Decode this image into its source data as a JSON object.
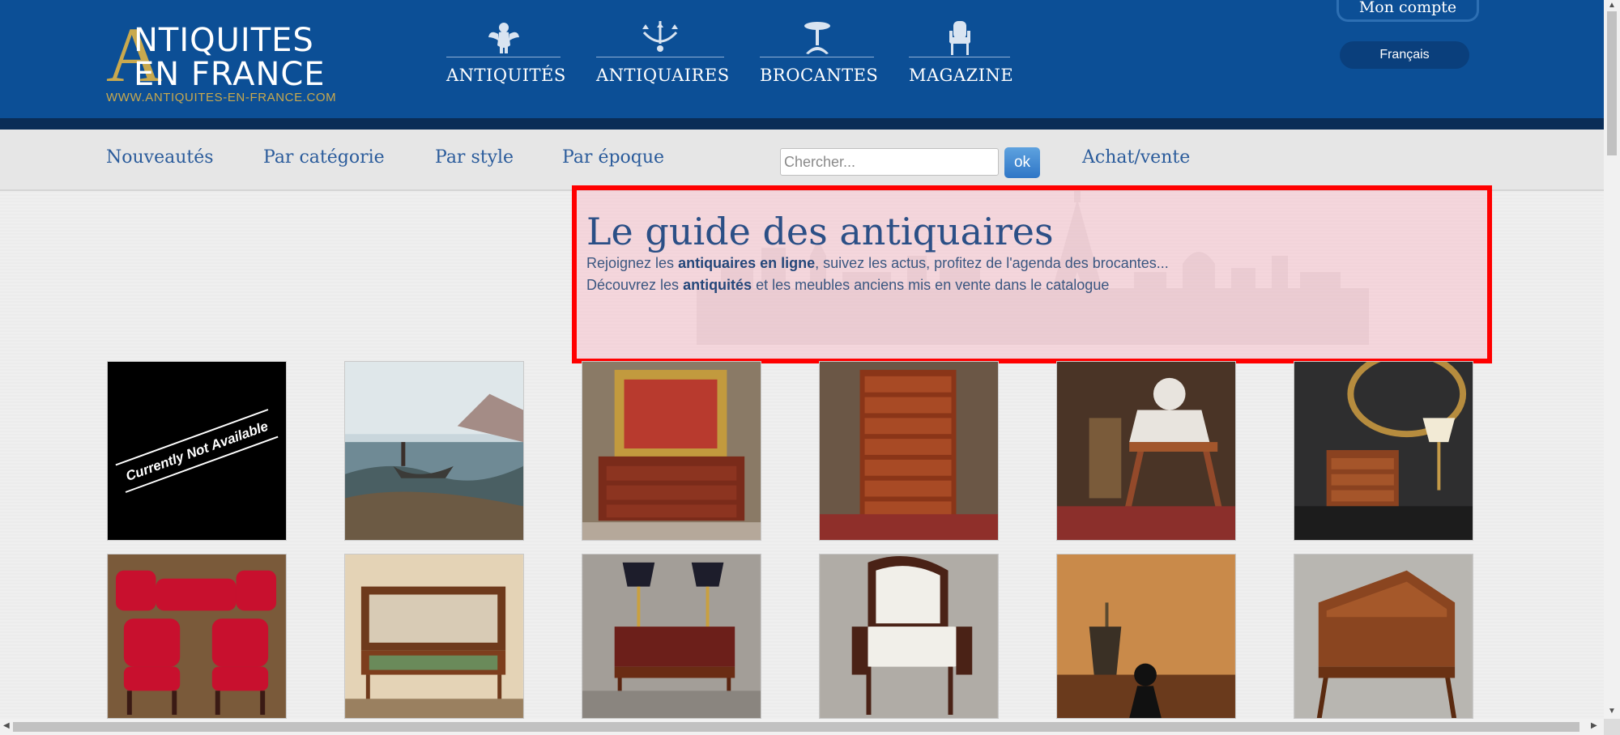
{
  "logo": {
    "big_letter": "A",
    "line1": "NTIQUITES",
    "line2": "EN FRANCE",
    "url": "WWW.ANTIQUITES-EN-FRANCE.COM"
  },
  "main_nav": [
    {
      "label": "ANTIQUITÉS",
      "icon": "cherub-icon"
    },
    {
      "label": "ANTIQUAIRES",
      "icon": "chandelier-icon"
    },
    {
      "label": "BROCANTES",
      "icon": "gueridon-table-icon"
    },
    {
      "label": "MAGAZINE",
      "icon": "armchair-icon"
    }
  ],
  "account": {
    "label": "Mon compte"
  },
  "language": {
    "label": "Français"
  },
  "sub_nav": {
    "links": [
      "Nouveautés",
      "Par catégorie",
      "Par style",
      "Par époque"
    ],
    "search_placeholder": "Chercher...",
    "search_button": "ok",
    "achat_vente": "Achat/vente"
  },
  "hero": {
    "title": "Le guide des antiquaires",
    "line1_prefix": "Rejoignez les ",
    "line1_bold": "antiquaires en ligne",
    "line1_suffix": ", suivez les actus, profitez de l'agenda des brocantes...",
    "line2_prefix": "Découvrez les ",
    "line2_bold": "antiquités",
    "line2_suffix": " et les meubles anciens mis en vente dans le catalogue"
  },
  "products": [
    {
      "name": "currently-not-available",
      "overlay_text": "Currently Not Available"
    },
    {
      "name": "seascape-painting-boat"
    },
    {
      "name": "commode-with-mirror"
    },
    {
      "name": "tall-chest-of-drawers"
    },
    {
      "name": "marble-bust-on-stool"
    },
    {
      "name": "miniature-commode-lamp"
    },
    {
      "name": "red-velvet-chairs"
    },
    {
      "name": "secretary-desk-cabinet"
    },
    {
      "name": "writing-desk-lamps"
    },
    {
      "name": "white-armchair"
    },
    {
      "name": "perfume-atomizer"
    },
    {
      "name": "slant-front-desk"
    }
  ]
}
